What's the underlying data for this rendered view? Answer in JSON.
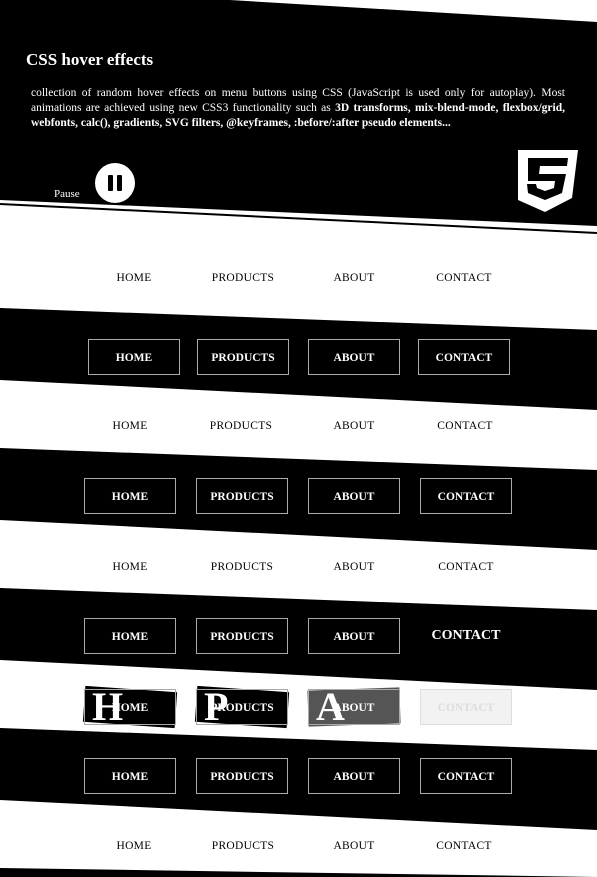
{
  "header": {
    "title": "CSS hover effects",
    "description_plain": "collection of random hover effects on menu buttons using CSS (JavaScript is used only for autoplay). Most animations are achieved using new CSS3 functionality such as ",
    "description_bold": "3D transforms, mix-blend-mode, flexbox/grid, webfonts, calc(), gradients, SVG filters, @keyframes, :before/:after pseudo elements...",
    "pause_label": "Pause",
    "logo": "css3-logo"
  },
  "menus": [
    {
      "style": "plain",
      "items": [
        "HOME",
        "PRODUCTS",
        "ABOUT",
        "CONTACT"
      ]
    },
    {
      "style": "boxed",
      "items": [
        "HOME",
        "PRODUCTS",
        "ABOUT",
        "CONTACT"
      ]
    },
    {
      "style": "plain",
      "items": [
        "HOME",
        "PRODUCTS",
        "ABOUT",
        "CONTACT"
      ]
    },
    {
      "style": "boxed",
      "items": [
        "HOME",
        "PRODUCTS",
        "ABOUT",
        "CONTACT"
      ]
    },
    {
      "style": "plain",
      "items": [
        "HOME",
        "PRODUCTS",
        "ABOUT",
        "CONTACT"
      ]
    },
    {
      "style": "boxed",
      "items": [
        "HOME",
        "PRODUCTS",
        "ABOUT",
        "CONTACT"
      ]
    },
    {
      "style": "boxed",
      "items": [
        "HOME",
        "PRODUCTS",
        "ABOUT",
        "CONTACT"
      ],
      "letters": [
        "H",
        "P",
        "A"
      ]
    },
    {
      "style": "boxed",
      "items": [
        "HOME",
        "PRODUCTS",
        "ABOUT",
        "CONTACT"
      ]
    },
    {
      "style": "plain",
      "items": [
        "HOME",
        "PRODUCTS",
        "ABOUT",
        "CONTACT"
      ]
    }
  ],
  "colors": {
    "background": "#000000",
    "foreground": "#ffffff"
  }
}
